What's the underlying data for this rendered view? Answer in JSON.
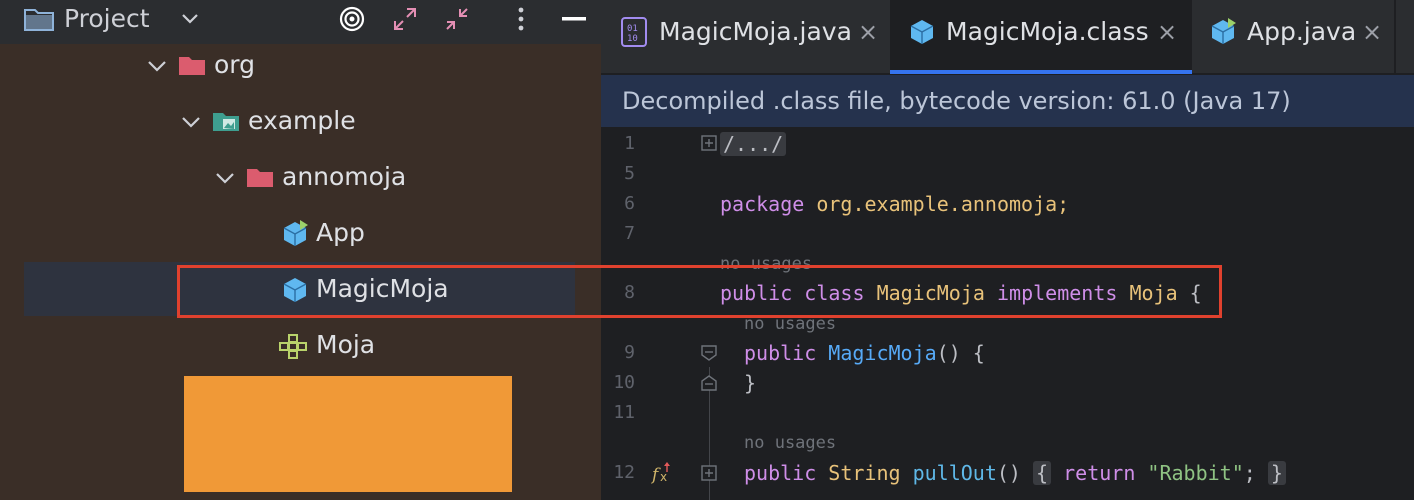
{
  "project_panel": {
    "title": "Project",
    "icons": [
      "folder-icon",
      "chevron-down-icon",
      "target-icon",
      "expand-all-icon",
      "collapse-all-icon",
      "more-vertical-icon",
      "minimize-icon"
    ],
    "tree": [
      {
        "label": "org",
        "icon": "folder-icon",
        "chevron": "expanded"
      },
      {
        "label": "example",
        "icon": "resources-folder-icon",
        "chevron": "expanded"
      },
      {
        "label": "annomoja",
        "icon": "folder-icon",
        "chevron": "expanded"
      },
      {
        "label": "App",
        "icon": "class-file-icon"
      },
      {
        "label": "MagicMoja",
        "icon": "class-file-icon",
        "selected": true
      },
      {
        "label": "Moja",
        "icon": "interface-icon"
      }
    ]
  },
  "editor": {
    "tabs": [
      {
        "label": "MagicMoja.java",
        "icon": "java-file-icon",
        "close": "×"
      },
      {
        "label": "MagicMoja.class",
        "icon": "class-file-icon",
        "close": "×",
        "active": true
      },
      {
        "label": "App.java",
        "icon": "class-file-icon",
        "close": "×"
      }
    ],
    "banner": "Decompiled .class file, bytecode version: 61.0 (Java 17)",
    "line_numbers": [
      "1",
      "5",
      "6",
      "7",
      "8",
      "9",
      "10",
      "11",
      "12"
    ],
    "code": {
      "l1": "/.../",
      "l6_kw": "package",
      "l6_rest": " org.example.annomoja;",
      "hint_class": "no usages",
      "l8_kw1": "public",
      "l8_kw2": "class",
      "l8_name": "MagicMoja",
      "l8_kw3": "implements",
      "l8_iface": "Moja",
      "l8_brace": " {",
      "hint_ctor": "no usages",
      "l9_kw": "public",
      "l9_name": "MagicMoja",
      "l9_rest": "() {",
      "l10": "}",
      "hint_method": "no usages",
      "l12_kw": "public",
      "l12_type": "String",
      "l12_name": "pullOut",
      "l12_parens": "()",
      "l12_open": "{",
      "l12_ret": "return",
      "l12_str": "\"Rabbit\"",
      "l12_semi": ";",
      "l12_close": "}"
    }
  },
  "colors": {
    "highlight_box": "#e0412e",
    "redaction": "#f09937",
    "accent": "#3574f0"
  }
}
